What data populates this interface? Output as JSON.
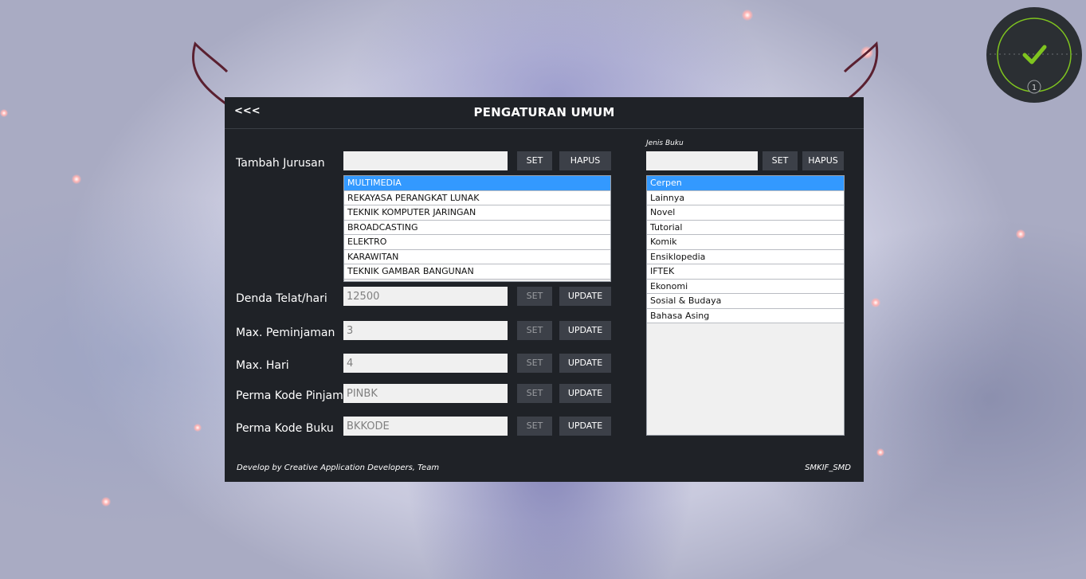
{
  "header": {
    "back_label": "<<<",
    "title": "PENGATURAN UMUM"
  },
  "jurusan": {
    "label": "Tambah Jurusan",
    "input_value": "",
    "set_label": "SET",
    "hapus_label": "HAPUS",
    "items": [
      "MULTIMEDIA",
      "REKAYASA PERANGKAT LUNAK",
      "TEKNIK KOMPUTER JARINGAN",
      "BROADCASTING",
      "ELEKTRO",
      "KARAWITAN",
      "TEKNIK GAMBAR BANGUNAN"
    ],
    "selected_item": "MULTIMEDIA"
  },
  "settings": [
    {
      "label": "Denda Telat/hari",
      "value": "12500",
      "set_label": "SET",
      "update_label": "UPDATE"
    },
    {
      "label": "Max. Peminjaman",
      "value": "3",
      "set_label": "SET",
      "update_label": "UPDATE"
    },
    {
      "label": "Max. Hari",
      "value": "4",
      "set_label": "SET",
      "update_label": "UPDATE"
    },
    {
      "label": "Perma Kode Pinjam",
      "value": "PINBK",
      "set_label": "SET",
      "update_label": "UPDATE"
    },
    {
      "label": "Perma Kode Buku",
      "value": "BKKODE",
      "set_label": "SET",
      "update_label": "UPDATE"
    }
  ],
  "jenis_buku": {
    "label": "Jenis Buku",
    "input_value": "",
    "set_label": "SET",
    "hapus_label": "HAPUS",
    "items": [
      "Cerpen",
      "Lainnya",
      "Novel",
      "Tutorial",
      "Komik",
      "Ensiklopedia",
      "IFTEK",
      "Ekonomi",
      "Sosial & Budaya",
      "Bahasa Asing"
    ],
    "selected_item": "Cerpen"
  },
  "footer": {
    "credit": "Develop by Creative Application Developers, Team",
    "brand": "SMKIF_SMD"
  },
  "status_widget": {
    "icon": "checkmark-icon",
    "count": "1",
    "accent_color": "#7fc41f"
  },
  "colors": {
    "panel_bg": "#1f2227",
    "button_bg": "#3c4048",
    "selection": "#3399ff"
  }
}
